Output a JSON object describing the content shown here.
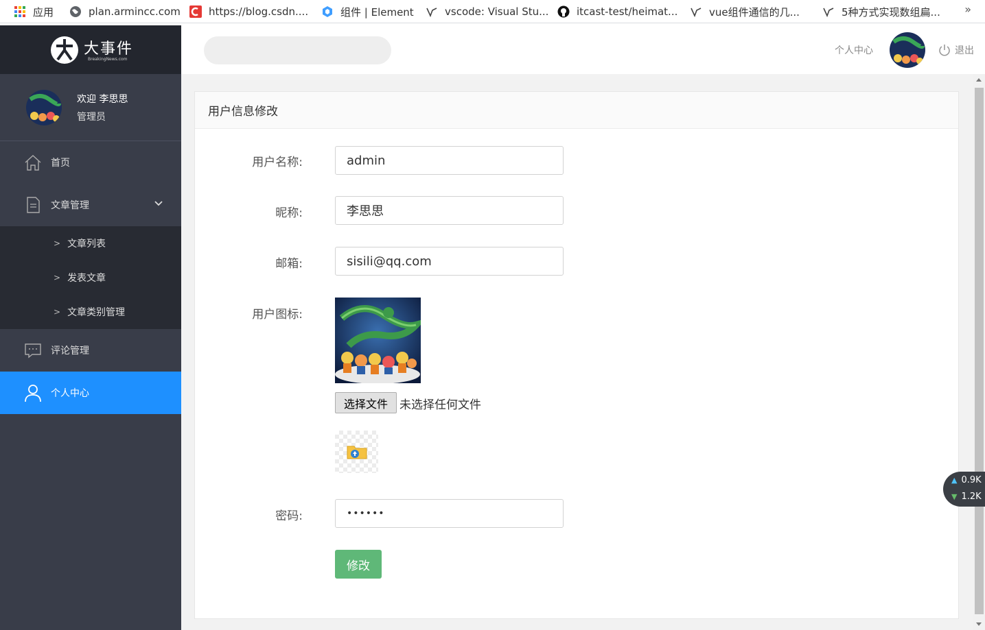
{
  "bookmarks": [
    {
      "label": "应用",
      "icon": "apps-grid-icon"
    },
    {
      "label": "plan.armincc.com",
      "icon": "globe-icon"
    },
    {
      "label": "https://blog.csdn....",
      "icon": "csdn-icon"
    },
    {
      "label": "组件 | Element",
      "icon": "element-icon"
    },
    {
      "label": "vscode: Visual Stu...",
      "icon": "yuque-icon"
    },
    {
      "label": "itcast-test/heimat...",
      "icon": "github-icon"
    },
    {
      "label": "vue组件通信的几...",
      "icon": "yuque-icon"
    },
    {
      "label": "5种方式实现数组扁...",
      "icon": "yuque-icon"
    }
  ],
  "bookmarks_more": "»",
  "header": {
    "logo_text": "大事件",
    "logo_sub": "BreakingNews.com",
    "personal_center": "个人中心",
    "logout": "退出"
  },
  "sidebar": {
    "welcome": "欢迎 李思思",
    "role": "管理员",
    "items": [
      {
        "label": "首页",
        "icon": "home-icon"
      },
      {
        "label": "文章管理",
        "icon": "document-icon"
      },
      {
        "label": "评论管理",
        "icon": "comment-icon"
      },
      {
        "label": "个人中心",
        "icon": "user-icon"
      }
    ],
    "submenu": [
      {
        "label": "文章列表"
      },
      {
        "label": "发表文章"
      },
      {
        "label": "文章类别管理"
      }
    ]
  },
  "card": {
    "title": "用户信息修改"
  },
  "form": {
    "username_label": "用户名称:",
    "username_value": "admin",
    "nickname_label": "昵称:",
    "nickname_value": "李思思",
    "email_label": "邮箱:",
    "email_value": "sisili@qq.com",
    "avatar_label": "用户图标:",
    "file_button": "选择文件",
    "file_status": "未选择任何文件",
    "password_label": "密码:",
    "password_value": "••••••",
    "submit": "修改"
  },
  "net_widget": {
    "up": "0.9K",
    "down": "1.2K"
  },
  "colors": {
    "sidebar_bg": "#393d49",
    "active_bg": "#1e90ff",
    "submit_bg": "#5fb878"
  }
}
